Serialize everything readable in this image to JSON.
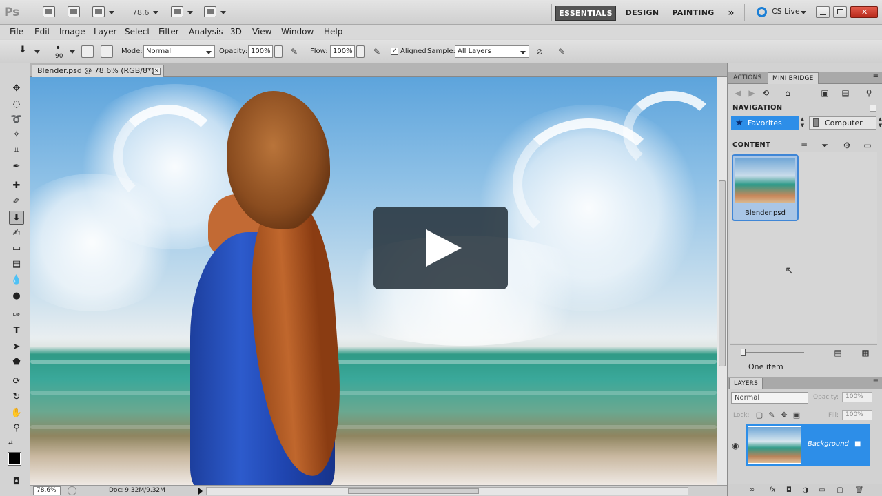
{
  "appbar": {
    "logo": "Ps",
    "zoom": "78.6",
    "workspaces": [
      "ESSENTIALS",
      "DESIGN",
      "PAINTING"
    ],
    "more": "»",
    "cs_live": "CS Live"
  },
  "menu": [
    "File",
    "Edit",
    "Image",
    "Layer",
    "Select",
    "Filter",
    "Analysis",
    "3D",
    "View",
    "Window",
    "Help"
  ],
  "options": {
    "brush_size": "90",
    "mode_label": "Mode:",
    "mode_value": "Normal",
    "opacity_label": "Opacity:",
    "opacity_value": "100%",
    "flow_label": "Flow:",
    "flow_value": "100%",
    "aligned_label": "Aligned",
    "sample_label": "Sample:",
    "sample_value": "All Layers"
  },
  "document": {
    "tab_title": "Blender.psd @ 78.6% (RGB/8*)",
    "close": "×"
  },
  "status": {
    "zoom": "78.6%",
    "doc_size": "Doc: 9.32M/9.32M"
  },
  "panels": {
    "tabs": [
      "ACTIONS",
      "MINI BRIDGE"
    ],
    "navigation_title": "NAVIGATION",
    "favorites": "Favorites",
    "computer": "Computer",
    "content_title": "CONTENT",
    "thumb_caption": "Blender.psd",
    "item_count": "One item",
    "layers_tab": "LAYERS",
    "blend_mode": "Normal",
    "opacity_label": "Opacity:",
    "opacity_value": "100%",
    "lock_label": "Lock:",
    "fill_label": "Fill:",
    "fill_value": "100%",
    "layer_name": "Background"
  },
  "icons": {
    "star": "★",
    "eye": "👁",
    "lock": "🔒",
    "play": "play-icon"
  }
}
